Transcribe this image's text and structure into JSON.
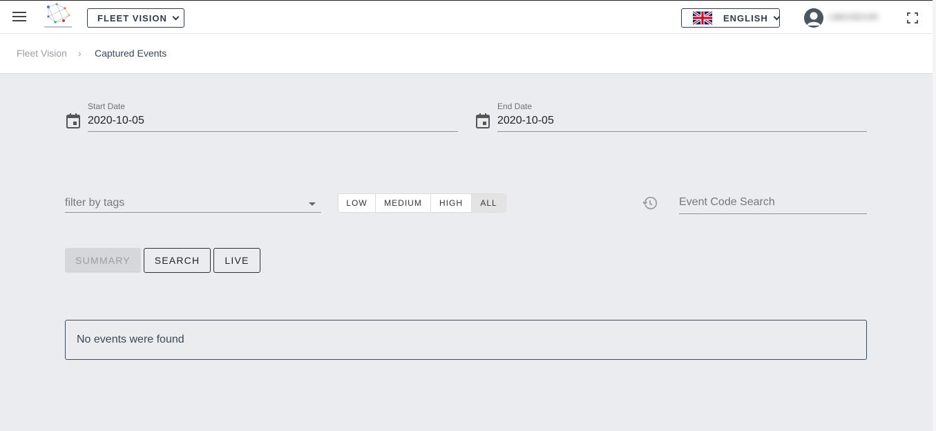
{
  "header": {
    "app_selector_label": "FLEET VISION",
    "language_label": "ENGLISH",
    "username": "UBKKBXHR"
  },
  "breadcrumb": {
    "root": "Fleet Vision",
    "separator": "›",
    "current": "Captured Events"
  },
  "filters": {
    "start_date": {
      "label": "Start Date",
      "value": "2020-10-05"
    },
    "end_date": {
      "label": "End Date",
      "value": "2020-10-05"
    },
    "tags_placeholder": "filter by tags",
    "severity": [
      "LOW",
      "MEDIUM",
      "HIGH",
      "ALL"
    ],
    "severity_selected": "ALL",
    "event_code_placeholder": "Event Code Search"
  },
  "actions": {
    "summary": "SUMMARY",
    "search": "SEARCH",
    "live": "LIVE"
  },
  "results": {
    "empty_message": "No events were found"
  },
  "colors": {
    "background": "#ebecef",
    "accent_dark": "#2f3a4a"
  }
}
